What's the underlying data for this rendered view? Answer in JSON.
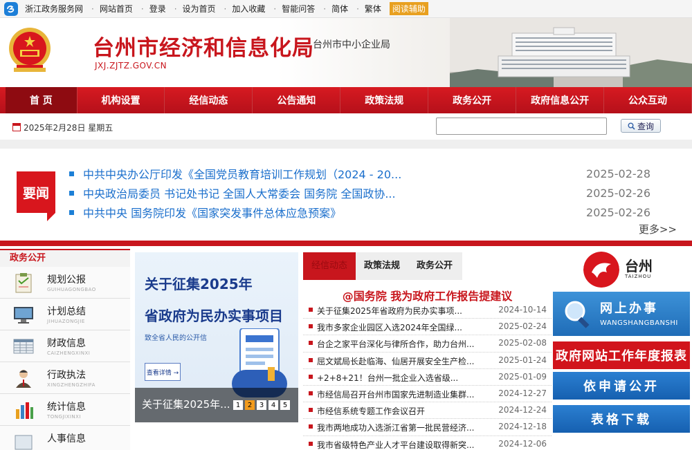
{
  "topbar": {
    "items": [
      "浙江政务服务网",
      "网站首页",
      "登录",
      "设为首页",
      "加入收藏",
      "智能问答",
      "简体",
      "繁体"
    ],
    "assist_label": "阅读辅助"
  },
  "banner": {
    "title": "台州市经济和信息化局",
    "subtitle": "台州市中小企业局",
    "url": "JXJ.ZJTZ.GOV.CN"
  },
  "nav": {
    "tabs": [
      "首 页",
      "机构设置",
      "经信动态",
      "公告通知",
      "政策法规",
      "政务公开",
      "政府信息公开",
      "公众互动"
    ]
  },
  "datebar": {
    "date": "2025年2月28日 星期五",
    "search_placeholder": "",
    "search_label": "查询"
  },
  "headlines": {
    "badge": "要闻",
    "items": [
      {
        "title": "中共中央办公厅印发《全国党员教育培训工作规划（2024 - 20...",
        "date": "2025-02-28"
      },
      {
        "title": "中央政治局委员 书记处书记 全国人大常委会 国务院 全国政协...",
        "date": "2025-02-26"
      },
      {
        "title": "中共中央 国务院印发《国家突发事件总体应急预案》",
        "date": "2025-02-26"
      }
    ],
    "more": "更多>>"
  },
  "sidebar": {
    "title": "政务公开",
    "items": [
      {
        "label": "规划公报",
        "pinyin": "GUIHUAGONGBAO"
      },
      {
        "label": "计划总结",
        "pinyin": "JIHUAZONGJIE"
      },
      {
        "label": "财政信息",
        "pinyin": "CAIZHENGXINXI"
      },
      {
        "label": "行政执法",
        "pinyin": "XINGZHENGZHIFA"
      },
      {
        "label": "统计信息",
        "pinyin": "TONGJIXINXI"
      },
      {
        "label": "人事信息",
        "pinyin": ""
      }
    ]
  },
  "slideshow": {
    "line1": "关于征集2025年",
    "line2": "省政府为民办实事项目",
    "line3": "致全省人民的公开信",
    "detail": "查看详情 →",
    "caption": "关于征集2025年...",
    "pages": [
      "1",
      "2",
      "3",
      "4",
      "5"
    ],
    "active_page": "2"
  },
  "news": {
    "tabs": [
      "经信动态",
      "政策法规",
      "政务公开"
    ],
    "feature": "@国务院 我为政府工作报告提建议",
    "items": [
      {
        "title": "关于征集2025年省政府为民办实事项...",
        "date": "2024-10-14"
      },
      {
        "title": "我市多家企业园区入选2024年全国绿...",
        "date": "2025-02-24"
      },
      {
        "title": "台企之家平台深化与律所合作，助力台州...",
        "date": "2025-02-08"
      },
      {
        "title": "屈文斌局长赴临海、仙居开展安全生产检...",
        "date": "2025-01-24"
      },
      {
        "title": "+2+8+21！台州一批企业入选省级...",
        "date": "2025-01-09"
      },
      {
        "title": "市经信局召开台州市国家先进制造业集群...",
        "date": "2024-12-27"
      },
      {
        "title": "市经信系统专题工作会议召开",
        "date": "2024-12-24"
      },
      {
        "title": "我市两地成功入选浙江省第一批民营经济...",
        "date": "2024-12-18"
      },
      {
        "title": "我市省级特色产业人才平台建设取得新突...",
        "date": "2024-12-06"
      }
    ]
  },
  "right": {
    "taizhou_cn": "台州",
    "taizhou_en": "TAIZHOU",
    "wsbs_cn": "网上办事",
    "wsbs_en": "WANGSHANGBANSHI",
    "report": "政府网站工作年度报表",
    "apply": "依申请公开",
    "forms": "表格下载"
  }
}
